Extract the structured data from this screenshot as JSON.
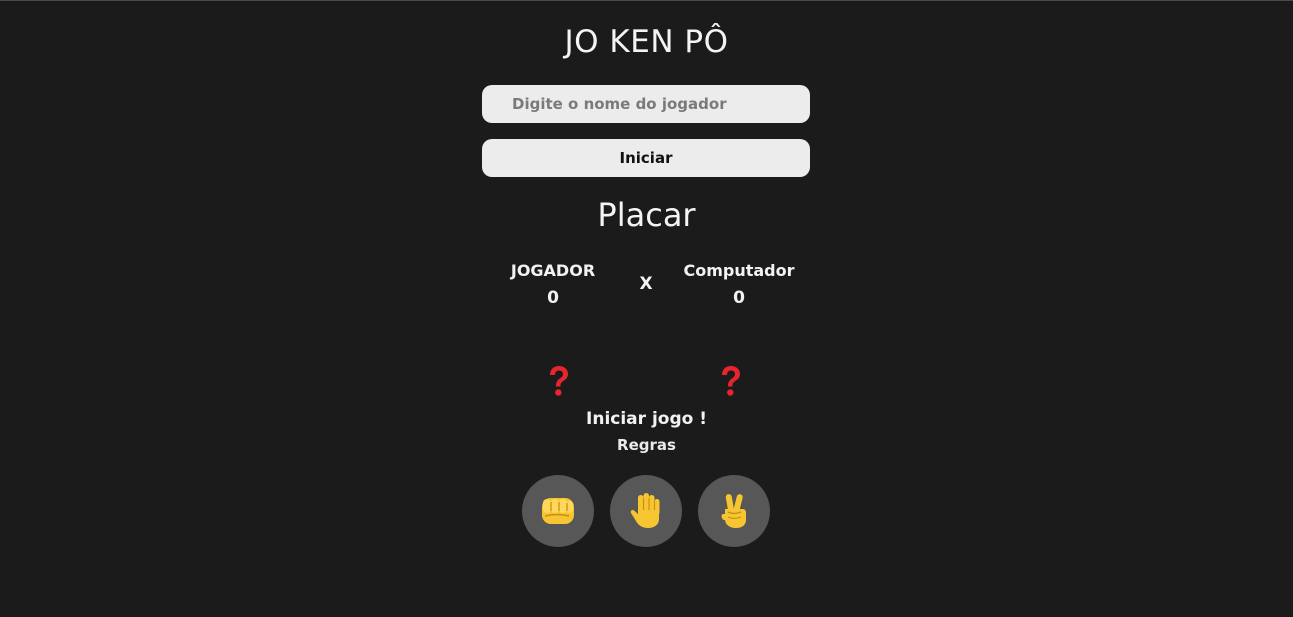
{
  "header": {
    "title": "JO KEN PÔ"
  },
  "form": {
    "name_placeholder": "Digite o nome do jogador",
    "start_label": "Iniciar"
  },
  "scoreboard": {
    "title": "Placar",
    "player_label": "JOGADOR",
    "player_score": "0",
    "versus": "X",
    "computer_label": "Computador",
    "computer_score": "0"
  },
  "choices": {
    "player_icon": "question-mark-icon",
    "computer_icon": "question-mark-icon",
    "icon_color": "#e8242f"
  },
  "status_text": "Iniciar jogo !",
  "rules_label": "Regras",
  "moves": [
    {
      "icon": "fist-icon"
    },
    {
      "icon": "raised-hand-icon"
    },
    {
      "icon": "victory-hand-icon"
    }
  ],
  "colors": {
    "background": "#1b1b1b",
    "input_bg": "#ececec",
    "move_button_bg": "#575757",
    "hand_color": "#f7c531"
  }
}
